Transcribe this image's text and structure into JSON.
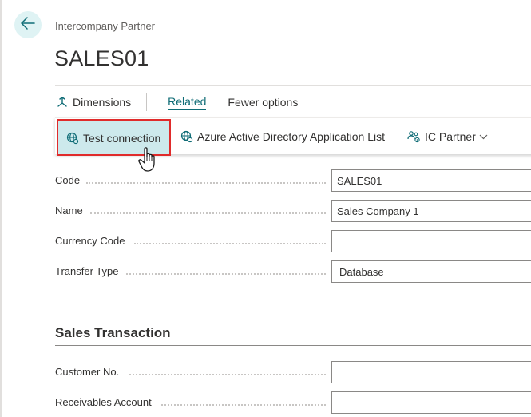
{
  "header": {
    "back_icon": "arrow-left-icon",
    "caption": "Intercompany Partner",
    "title": "SALES01"
  },
  "actions": {
    "dimensions_label": "Dimensions",
    "related_label": "Related",
    "fewer_options_label": "Fewer options"
  },
  "toolbar": {
    "test_connection_label": "Test connection",
    "aad_app_list_label": "Azure Active Directory Application List",
    "ic_partner_label": "IC Partner"
  },
  "general": {
    "fields": [
      {
        "label": "Code",
        "value": "SALES01"
      },
      {
        "label": "Name",
        "value": "Sales Company 1"
      },
      {
        "label": "Currency Code",
        "value": ""
      },
      {
        "label": "Transfer Type",
        "value": "Database"
      }
    ]
  },
  "sales_transaction": {
    "title": "Sales Transaction",
    "fields": [
      {
        "label": "Customer No.",
        "value": ""
      },
      {
        "label": "Receivables Account",
        "value": ""
      }
    ]
  },
  "colors": {
    "accent": "#0f6c76",
    "highlight_border": "#e02b2b",
    "button_active_bg": "#cde9ec",
    "back_button_bg": "#dff3f4"
  }
}
